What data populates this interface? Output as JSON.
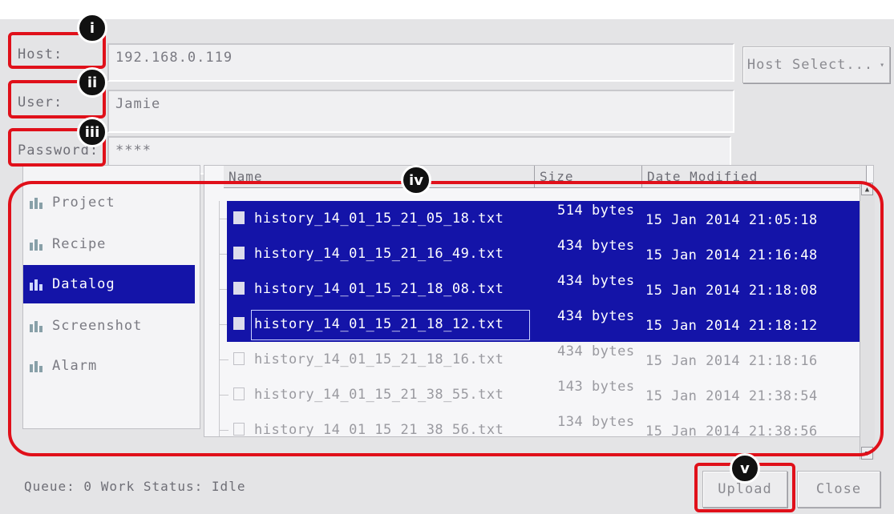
{
  "form": {
    "host_label": "Host:",
    "host_value": "192.168.0.119",
    "user_label": "User:",
    "user_value": "Jamie",
    "password_label": "Password:",
    "password_value": "****",
    "host_select_label": "Host Select..."
  },
  "annotations": [
    "i",
    "ii",
    "iii",
    "iv",
    "v"
  ],
  "sidebar": {
    "items": [
      {
        "label": "Project",
        "icon": "folder-icon",
        "active": false
      },
      {
        "label": "Recipe",
        "icon": "folder-icon",
        "active": false
      },
      {
        "label": "Datalog",
        "icon": "folder-icon",
        "active": true
      },
      {
        "label": "Screenshot",
        "icon": "folder-icon",
        "active": false
      },
      {
        "label": "Alarm",
        "icon": "folder-icon",
        "active": false
      }
    ]
  },
  "file_list": {
    "columns": [
      "Name",
      "Size",
      "Date Modified"
    ],
    "rows": [
      {
        "name": "history_14_01_15_21_05_18.txt",
        "size": "514 bytes",
        "date": "15 Jan 2014 21:05:18",
        "selected": true
      },
      {
        "name": "history_14_01_15_21_16_49.txt",
        "size": "434 bytes",
        "date": "15 Jan 2014 21:16:48",
        "selected": true
      },
      {
        "name": "history_14_01_15_21_18_08.txt",
        "size": "434 bytes",
        "date": "15 Jan 2014 21:18:08",
        "selected": true
      },
      {
        "name": "history_14_01_15_21_18_12.txt",
        "size": "434 bytes",
        "date": "15 Jan 2014 21:18:12",
        "selected": true
      },
      {
        "name": "history_14_01_15_21_18_16.txt",
        "size": "434 bytes",
        "date": "15 Jan 2014 21:18:16",
        "selected": false
      },
      {
        "name": "history_14_01_15_21_38_55.txt",
        "size": "143 bytes",
        "date": "15 Jan 2014 21:38:54",
        "selected": false
      },
      {
        "name": "history_14_01_15_21_38_56.txt",
        "size": "134 bytes",
        "date": "15 Jan 2014 21:38:56",
        "selected": false
      }
    ]
  },
  "footer": {
    "status_text": "Queue: 0 Work Status: Idle",
    "upload_label": "Upload",
    "close_label": "Close"
  },
  "colors": {
    "selection": "#1414a8",
    "annotation_border": "#e0101a",
    "background": "#e4e4e6"
  }
}
